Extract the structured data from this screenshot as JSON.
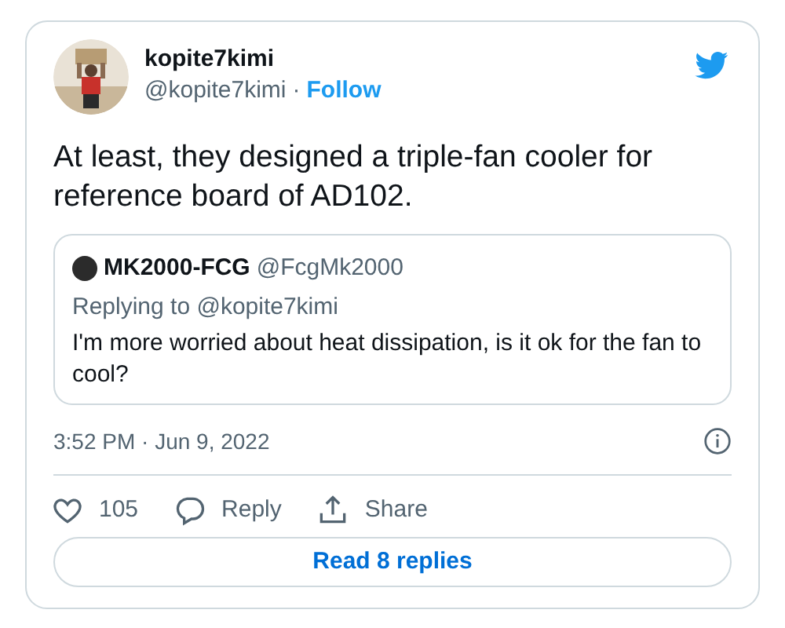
{
  "author": {
    "name": "kopite7kimi",
    "handle": "@kopite7kimi",
    "separator": "·",
    "follow": "Follow"
  },
  "tweet_text": "At least, they designed a triple-fan cooler for reference board of AD102.",
  "quoted_tweet": {
    "name": "MK2000-FCG",
    "handle": "@FcgMk2000",
    "replying_to": "Replying to @kopite7kimi",
    "text": "I'm more worried about heat dissipation, is it ok for the fan to cool?"
  },
  "timestamp": "3:52 PM · Jun 9, 2022",
  "actions": [
    {
      "kind": "like",
      "label": "105"
    },
    {
      "kind": "reply",
      "label": "Reply"
    },
    {
      "kind": "share",
      "label": "Share"
    }
  ],
  "read_replies": "Read 8 replies"
}
